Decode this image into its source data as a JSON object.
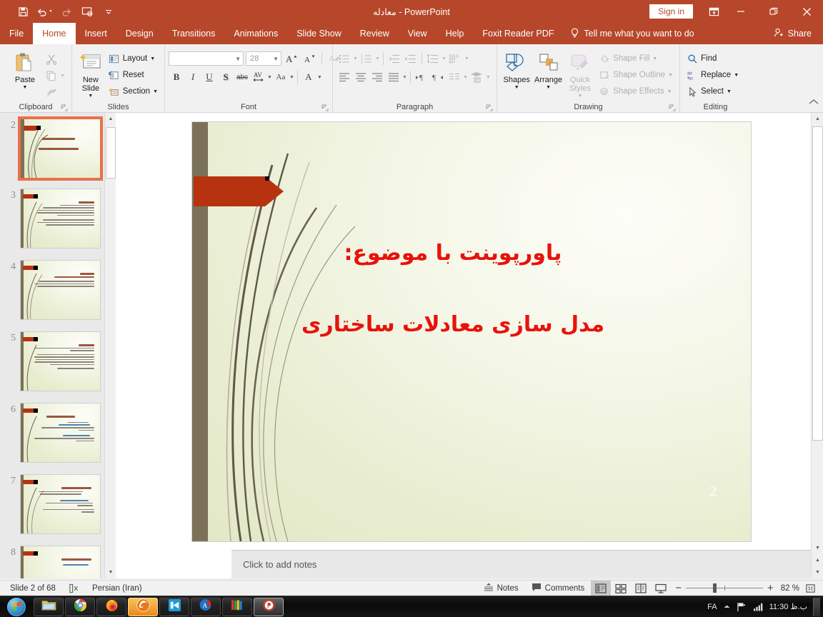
{
  "window": {
    "title": "معادله  -  PowerPoint",
    "signin_label": "Sign in",
    "ribbon_display_icon": "ribbon-display-options-icon",
    "minimize_icon": "minimize-icon",
    "restore_icon": "restore-icon",
    "close_icon": "close-icon",
    "accent_color": "#b7472a"
  },
  "quick_access": [
    {
      "name": "save",
      "icon": "save-icon"
    },
    {
      "name": "undo",
      "icon": "undo-icon"
    },
    {
      "name": "redo",
      "icon": "redo-icon"
    },
    {
      "name": "start-from-beginning",
      "icon": "slideshow-icon"
    },
    {
      "name": "customize-quick-access",
      "icon": "chevron-down-icon"
    }
  ],
  "tabs": [
    {
      "label": "File",
      "active": false
    },
    {
      "label": "Home",
      "active": true
    },
    {
      "label": "Insert",
      "active": false
    },
    {
      "label": "Design",
      "active": false
    },
    {
      "label": "Transitions",
      "active": false
    },
    {
      "label": "Animations",
      "active": false
    },
    {
      "label": "Slide Show",
      "active": false
    },
    {
      "label": "Review",
      "active": false
    },
    {
      "label": "View",
      "active": false
    },
    {
      "label": "Help",
      "active": false
    },
    {
      "label": "Foxit Reader PDF",
      "active": false
    }
  ],
  "tellme": {
    "label": "Tell me what you want to do",
    "icon": "lightbulb-icon"
  },
  "share": {
    "label": "Share",
    "icon": "share-person-icon"
  },
  "ribbon": {
    "clipboard": {
      "title": "Clipboard",
      "paste_label": "Paste",
      "cut_label": "Cut",
      "copy_label": "Copy",
      "format_painter_label": "Format Painter"
    },
    "slides": {
      "title": "Slides",
      "new_slide_label": "New Slide",
      "layout_label": "Layout",
      "reset_label": "Reset",
      "section_label": "Section"
    },
    "font": {
      "title": "Font",
      "font_name_value": "",
      "font_name_placeholder": "",
      "font_size_value": "28",
      "bold_label": "B",
      "italic_label": "I",
      "underline_label": "U",
      "shadow_label": "S",
      "strikethrough_label": "abc",
      "spacing_label": "AV",
      "change_case_label": "Aa",
      "font_color_label": "A",
      "increase_size_label": "A",
      "decrease_size_label": "A",
      "clear_formatting_label": "A"
    },
    "paragraph": {
      "title": "Paragraph"
    },
    "drawing": {
      "title": "Drawing",
      "shapes_label": "Shapes",
      "arrange_label": "Arrange",
      "quick_styles_label": "Quick Styles",
      "shape_fill_label": "Shape Fill",
      "shape_outline_label": "Shape Outline",
      "shape_effects_label": "Shape Effects"
    },
    "editing": {
      "title": "Editing",
      "find_label": "Find",
      "replace_label": "Replace",
      "select_label": "Select"
    },
    "collapse_ribbon_icon": "chevron-up-icon"
  },
  "thumbnails": {
    "selected": 2,
    "items": [
      {
        "number": "2",
        "kind": "title",
        "selected": true
      },
      {
        "number": "3",
        "kind": "content",
        "selected": false
      },
      {
        "number": "4",
        "kind": "content",
        "selected": false
      },
      {
        "number": "5",
        "kind": "content",
        "selected": false
      },
      {
        "number": "6",
        "kind": "content",
        "selected": false
      },
      {
        "number": "7",
        "kind": "content",
        "selected": false
      },
      {
        "number": "8",
        "kind": "content",
        "selected": false
      }
    ]
  },
  "slide": {
    "title_line1": "پاورپوینت با موضوع:",
    "title_line2": "مدل سازی معادلات ساختاری",
    "slide_number": "2",
    "title_color": "#e8120c",
    "accent_bar_color": "#7a7158",
    "arrow_color": "#b7330f"
  },
  "notes": {
    "placeholder": "Click to add notes"
  },
  "statusbar": {
    "slide_indicator": "Slide 2 of 68",
    "language": "Persian (Iran)",
    "spellcheck_icon": "spellcheck-icon",
    "notes_label": "Notes",
    "comments_label": "Comments",
    "zoom_level": "82 %",
    "zoom_out_label": "−",
    "zoom_in_label": "+",
    "views": [
      {
        "name": "normal-view",
        "active": true
      },
      {
        "name": "slide-sorter-view",
        "active": false
      },
      {
        "name": "reading-view",
        "active": false
      },
      {
        "name": "slide-show-view",
        "active": false
      }
    ],
    "fit_slide_icon": "fit-to-window-icon"
  },
  "taskbar": {
    "start_label": "Start",
    "items": [
      {
        "name": "file-explorer",
        "icon": "folder-icon",
        "state": "normal"
      },
      {
        "name": "google-chrome",
        "icon": "chrome-icon",
        "state": "normal"
      },
      {
        "name": "mozilla-firefox",
        "icon": "firefox-icon",
        "state": "normal"
      },
      {
        "name": "internet-download-manager",
        "icon": "idm-icon",
        "state": "active"
      },
      {
        "name": "free-download-manager",
        "icon": "blue-arrow-icon",
        "state": "normal"
      },
      {
        "name": "adobe-acrobat",
        "icon": "acrobat-icon",
        "state": "normal"
      },
      {
        "name": "winrar",
        "icon": "books-icon",
        "state": "normal"
      },
      {
        "name": "microsoft-powerpoint",
        "icon": "powerpoint-icon",
        "state": "current"
      }
    ],
    "tray": {
      "language": "FA",
      "show_hidden_icon": "chevron-up-icon",
      "network_icon": "network-flag-icon",
      "volume_icon": "signal-bars-icon",
      "clock": "11:30 ب.ظ"
    }
  }
}
